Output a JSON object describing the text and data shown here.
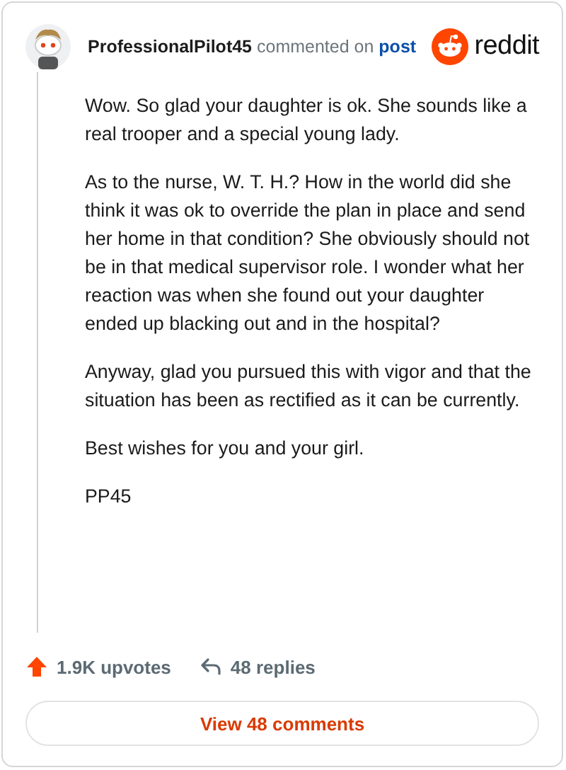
{
  "comment": {
    "author": "ProfessionalPilot45",
    "action": "commented on",
    "target": "post",
    "brand": "reddit",
    "paragraphs": [
      "Wow. So glad your daughter is ok. She sounds like a real trooper and a special young lady.",
      "As to the nurse, W. T. H.? How in the world did she think it was ok to override the plan in place and send her home in that condition? She obviously should not be in that medical supervisor role. I wonder what her reaction was when she found out your daughter ended up blacking out and in the hospital?",
      "Anyway, glad you pursued this with vigor and that the situation has been as rectified as it can be currently.",
      "Best wishes for you and your girl.",
      "PP45"
    ],
    "upvotes": "1.9K upvotes",
    "replies": "48 replies",
    "view_button": "View 48 comments"
  }
}
